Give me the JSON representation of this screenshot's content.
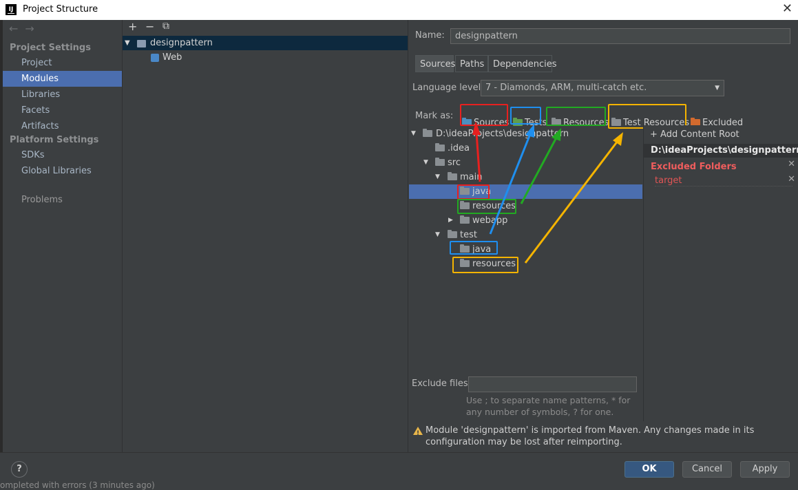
{
  "window": {
    "title": "Project Structure",
    "icon_text": "IJ"
  },
  "sidebar": {
    "back_icon": "←",
    "forward_icon": "→",
    "project_settings": "Project Settings",
    "project_items": [
      "Project",
      "Modules",
      "Libraries",
      "Facets",
      "Artifacts"
    ],
    "platform_settings": "Platform Settings",
    "platform_items": [
      "SDKs",
      "Global Libraries"
    ],
    "problems": "Problems"
  },
  "modules": {
    "add": "+",
    "remove": "−",
    "copy": "⧉",
    "root": "designpattern",
    "child": "Web"
  },
  "detail": {
    "name_label": "Name:",
    "name_value": "designpattern",
    "tabs": [
      "Sources",
      "Paths",
      "Dependencies"
    ],
    "language_label": "Language level:",
    "language_value": "7 - Diamonds, ARM, multi-catch etc.",
    "mark_as_label": "Mark as:",
    "mark_items": [
      "Sources",
      "Tests",
      "Resources",
      "Test Resources",
      "Excluded"
    ],
    "tree": [
      "D:\\ideaProjects\\designpattern",
      ".idea",
      "src",
      "main",
      "java",
      "resources",
      "webapp",
      "test",
      "java",
      "resources"
    ],
    "add_content_root": "Add Content Root",
    "root_path": "D:\\ideaProjects\\designpattern",
    "excluded_title": "Excluded Folders",
    "excluded_item": "target",
    "exclude_files_label": "Exclude files:",
    "exclude_hint": "Use ; to separate name patterns, * for any number of symbols, ? for one.",
    "warning": "Module 'designpattern' is imported from Maven. Any changes made in its configuration may be lost after reimporting."
  },
  "buttons": {
    "help": "?",
    "ok": "OK",
    "cancel": "Cancel",
    "apply": "Apply"
  },
  "status": "ompleted with errors (3 minutes ago)",
  "colors": {
    "sources": "#4b8fbf",
    "tests": "#5f9e4e",
    "resources": "#8a8f93",
    "excluded": "#d26a2e",
    "box_red": "#e8201f",
    "box_blue": "#1f8fef",
    "box_green": "#22aa22",
    "box_yellow": "#f5b400"
  }
}
